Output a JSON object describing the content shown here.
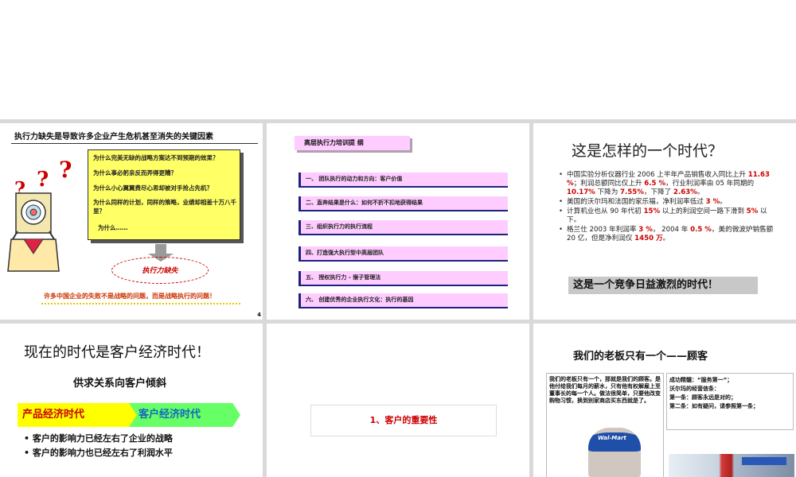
{
  "slide1": {
    "title": "执行力缺失是导致许多企业产生危机甚至消失的关键因素",
    "question_marks": [
      "?",
      "?",
      "?"
    ],
    "questions": [
      "为什么完美无缺的战略方案达不到预期的效果？",
      "为什么事必躬亲反而弄得更糟？",
      "为什么小心翼翼费尽心思却被对手抢占先机？",
      "为什么同样的计划，同样的策略，业绩却相差十万八千里？",
      "为什么……"
    ],
    "oval_label": "执行力缺失",
    "footer": "许多中国企业的失败不是战略的问题，而是战略执行的问题！",
    "page_number": "4"
  },
  "slide2": {
    "header": "高层执行力培训提 纲",
    "items": [
      "一、 团队执行的动力和方向：客户价值",
      "二、直奔结果是什么：如何不折不扣地获得结果",
      "三、组织执行力的执行流程",
      "四、打造强大执行型中高层团队",
      "五、 授权执行力 - 猴子管理法",
      "六、 创建优秀的企业执行文化：执行的基因"
    ]
  },
  "slide3": {
    "title": "这是怎样的一个时代？",
    "bullets": [
      {
        "t1": "中国实验分析仪器行业 2006 上半年产品销售收入同比上升 ",
        "r1": "11.63 %",
        "t2": "；利润总额同比仅上升 ",
        "r2": "6.5 %",
        "t3": "，行业利润率由 05 年同期的 ",
        "r3": "10.17%",
        "t4": " 下降为 ",
        "r4": "7.55%",
        "t5": "，下降了 ",
        "r5": "2.63%",
        "t6": "。"
      },
      {
        "t1": "美国的沃尔玛和法国的家乐福，净利润率低过 ",
        "r1": "3 %",
        "t2": "。"
      },
      {
        "t1": "计算机业也从 90 年代初 ",
        "r1": "15%",
        "t2": " 以上的利润空间一路下滑到 ",
        "r2": "5%",
        "t3": " 以下。"
      },
      {
        "t1": "格兰仕 2003 年利润率 ",
        "r1": "3 %",
        "t2": "， 2004 年 ",
        "r2": "0.5 %",
        "t3": "，美的微波炉销售额 20 亿，但是净利润仅 ",
        "r3": "1450 万",
        "t4": "。"
      }
    ],
    "banner": "这是一个竞争日益激烈的时代！"
  },
  "slide4": {
    "title": "现在的时代是客户经济时代！",
    "subtitle": "供求关系向客户倾斜",
    "stage1": "产品经济时代",
    "stage2": "客户经济时代",
    "bullets": [
      "客户的影响力已经左右了企业的战略",
      "客户的影响力也已经左右了利润水平"
    ]
  },
  "slide5": {
    "heading": "1、客户的重要性"
  },
  "slide6": {
    "title": "我们的老板只有一个——顾客",
    "left_text": "我们的老板只有一个，那就是我们的顾客。是他付给我们每月的薪水，只有他有权解雇上至董事长的每一个人。做法很简单，只要他改变购物习惯，换到别家商店买东西就是了。",
    "cap_text": "Wal-Mart",
    "right_lines": [
      "成功精髓：“服务第一”；",
      "沃尔玛的经营信条：",
      "第一条：顾客永远是对的；",
      "第二条：如有疑问，请参照第一条；"
    ]
  },
  "colors": {
    "accent_red": "#cc0000",
    "note_yellow": "#ffff66",
    "bar_pink": "#ffccff",
    "bar_navy": "#1a237e",
    "chevron_yellow": "#ffff00",
    "chevron_green": "#66ff66"
  }
}
